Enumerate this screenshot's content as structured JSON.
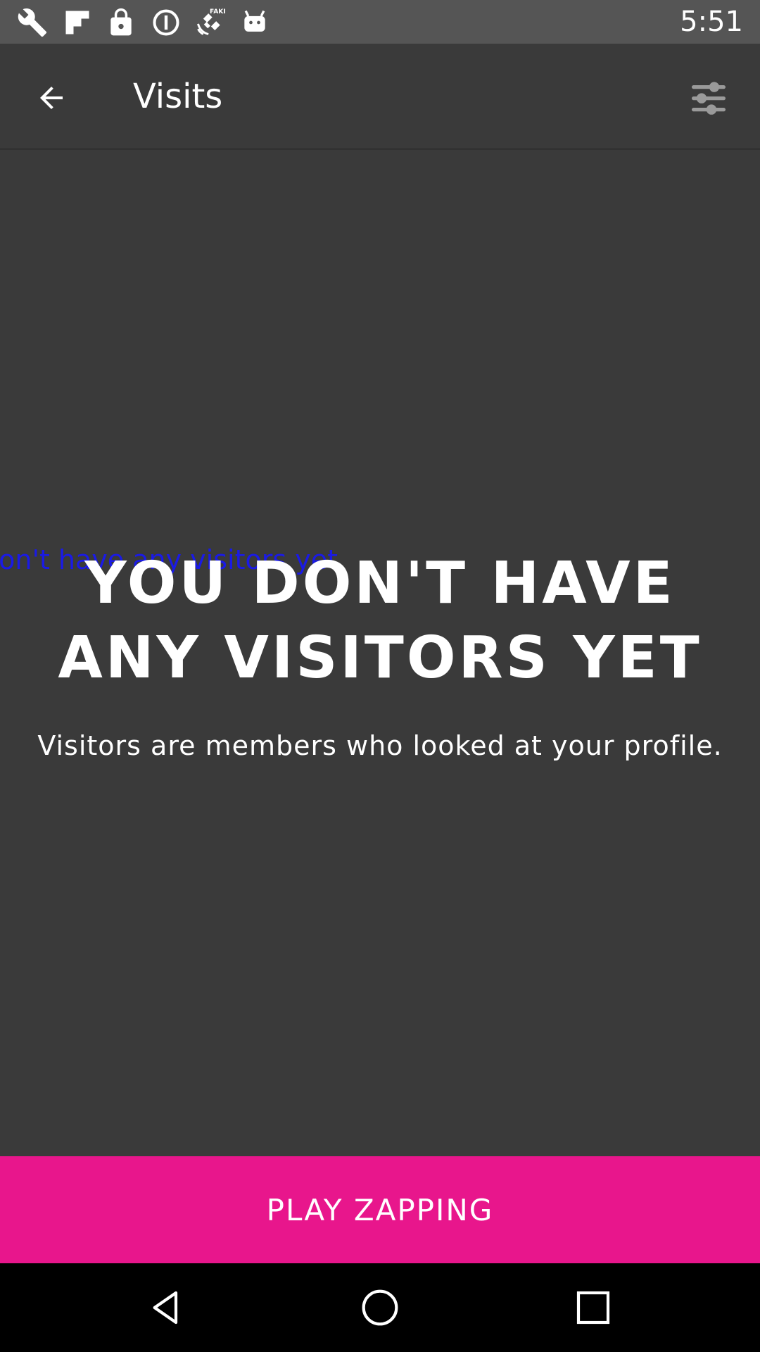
{
  "status_bar": {
    "time": "5:51",
    "icons": [
      "wrench-icon",
      "flipboard-icon",
      "lock-icon",
      "info-circle-icon",
      "fake-gps-icon",
      "android-icon"
    ]
  },
  "app_bar": {
    "title": "Visits",
    "back_icon": "arrow-back-icon",
    "filter_icon": "sliders-icon"
  },
  "empty_state": {
    "overlay_label": "on't have any visitors yet",
    "headline": "YOU DON'T HAVE ANY VISITORS YET",
    "subtitle": "Visitors are members who looked at your profile."
  },
  "cta": {
    "label": "PLAY ZAPPING"
  },
  "nav_bar": {
    "icons": [
      "back-triangle-icon",
      "home-circle-icon",
      "recents-square-icon"
    ]
  },
  "colors": {
    "background": "#3a3a3a",
    "status_bar": "#555555",
    "accent": "#e8168c",
    "overlay_text": "#1a1ae6"
  }
}
